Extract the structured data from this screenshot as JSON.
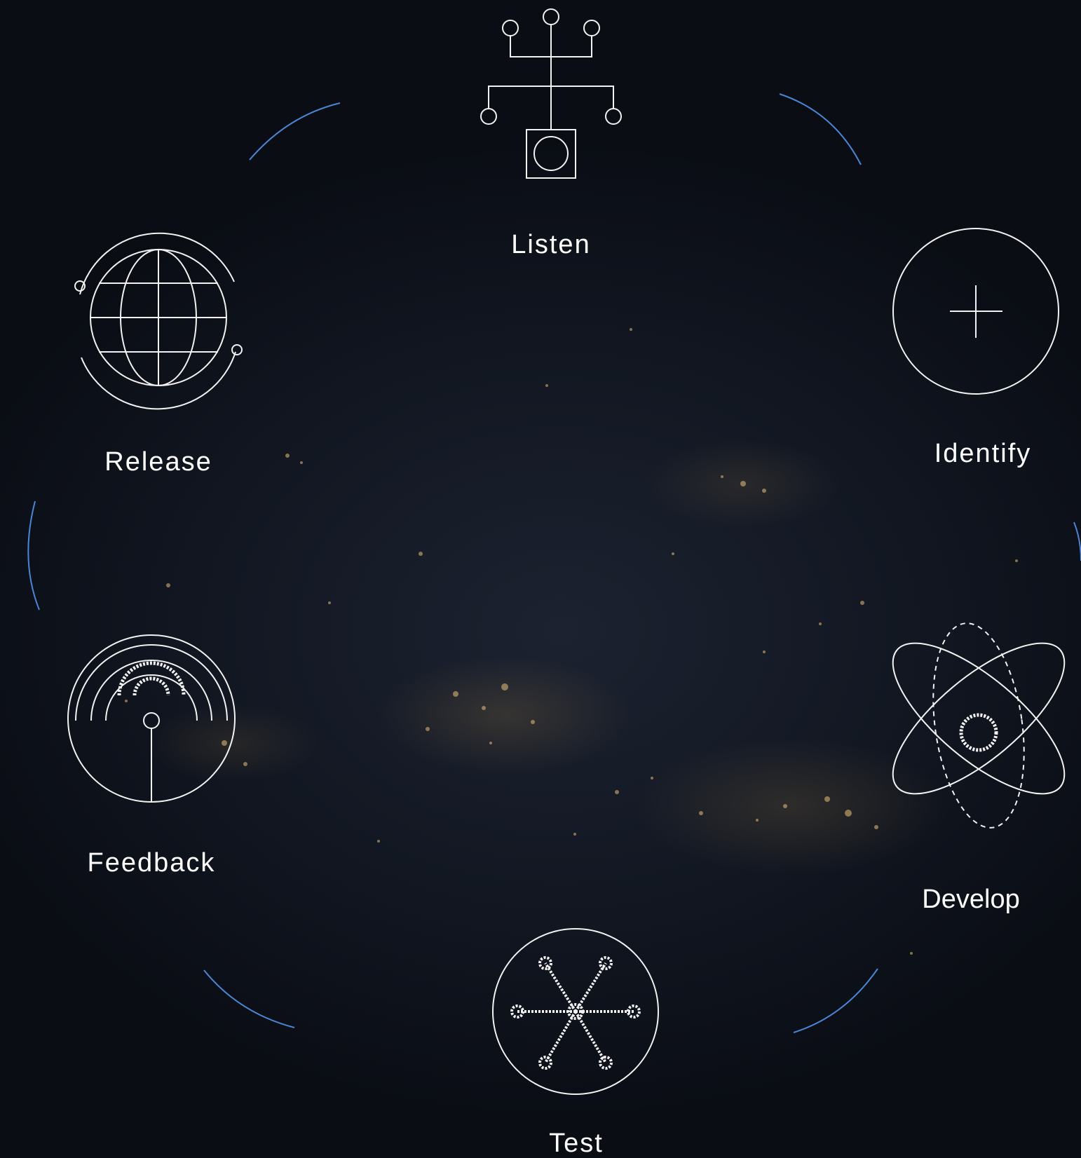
{
  "stages": [
    {
      "id": "listen",
      "label": "Listen",
      "icon": "hierarchy-tree-icon"
    },
    {
      "id": "identify",
      "label": "Identify",
      "icon": "plus-circle-icon"
    },
    {
      "id": "develop",
      "label": "Develop",
      "icon": "atom-icon"
    },
    {
      "id": "test",
      "label": "Test",
      "icon": "network-star-icon"
    },
    {
      "id": "feedback",
      "label": "Feedback",
      "icon": "signal-antenna-icon"
    },
    {
      "id": "release",
      "label": "Release",
      "icon": "globe-orbit-icon"
    }
  ],
  "colors": {
    "icon_stroke": "#f2f2f2",
    "label_text": "#ffffff",
    "connector_arc": "#4a86d6",
    "background": "#0b0e15"
  },
  "background_image": "night-earth-city-lights"
}
